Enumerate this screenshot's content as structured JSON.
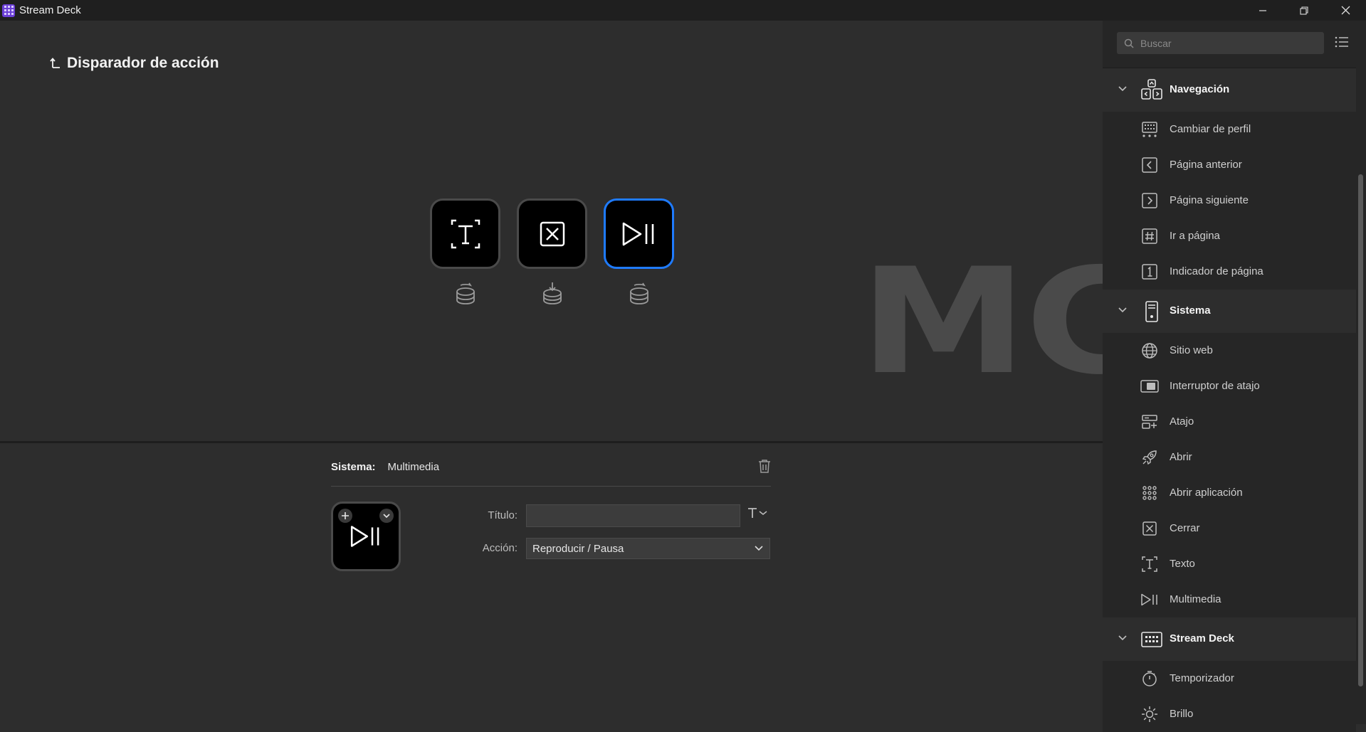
{
  "window": {
    "title": "Stream Deck"
  },
  "canvas": {
    "back_label": "Disparador de acción",
    "watermark": "MC",
    "keys": [
      {
        "icon": "text-icon",
        "selected": false
      },
      {
        "icon": "close-icon",
        "selected": false
      },
      {
        "icon": "play-pause-icon",
        "selected": true
      }
    ]
  },
  "inspector": {
    "category": "Sistema:",
    "action_name": "Multimedia",
    "title_label": "Título:",
    "title_value": "",
    "action_label": "Acción:",
    "action_value": "Reproducir / Pausa"
  },
  "sidebar": {
    "search_placeholder": "Buscar",
    "categories": [
      {
        "label": "Navegación",
        "icon": "navigation-icon",
        "items": [
          {
            "label": "Cambiar de perfil",
            "icon": "profile-switch-icon"
          },
          {
            "label": "Página anterior",
            "icon": "previous-page-icon"
          },
          {
            "label": "Página siguiente",
            "icon": "next-page-icon"
          },
          {
            "label": "Ir a página",
            "icon": "go-to-page-icon"
          },
          {
            "label": "Indicador de página",
            "icon": "page-indicator-icon"
          }
        ]
      },
      {
        "label": "Sistema",
        "icon": "system-icon",
        "items": [
          {
            "label": "Sitio web",
            "icon": "globe-icon"
          },
          {
            "label": "Interruptor de atajo",
            "icon": "hotkey-switch-icon"
          },
          {
            "label": "Atajo",
            "icon": "hotkey-icon"
          },
          {
            "label": "Abrir",
            "icon": "rocket-icon"
          },
          {
            "label": "Abrir aplicación",
            "icon": "app-grid-icon"
          },
          {
            "label": "Cerrar",
            "icon": "close-box-icon"
          },
          {
            "label": "Texto",
            "icon": "text-icon"
          },
          {
            "label": "Multimedia",
            "icon": "play-pause-icon"
          }
        ]
      },
      {
        "label": "Stream Deck",
        "icon": "stream-deck-icon",
        "items": [
          {
            "label": "Temporizador",
            "icon": "timer-icon"
          },
          {
            "label": "Brillo",
            "icon": "brightness-icon"
          }
        ]
      }
    ]
  }
}
